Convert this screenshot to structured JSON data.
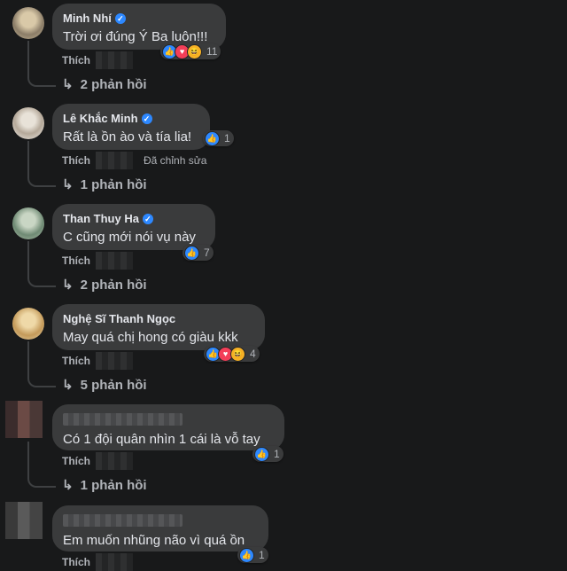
{
  "comments": [
    {
      "name": "Minh Nhí",
      "verified": true,
      "text": "Trời ơi đúng Ý Ba luôn!!!",
      "reactions": [
        "like",
        "love",
        "haha"
      ],
      "reaction_count": "11",
      "like_label": "Thích",
      "edited_label": "",
      "replies_label": "2 phản hồi"
    },
    {
      "name": "Lê Khắc Minh",
      "verified": true,
      "text": "Rất là ồn ào và tía lia!",
      "reactions": [
        "like"
      ],
      "reaction_count": "1",
      "like_label": "Thích",
      "edited_label": "Đã chỉnh sửa",
      "replies_label": "1 phản hồi"
    },
    {
      "name": "Than Thuy Ha",
      "verified": true,
      "text": "C cũng mới nói vụ này",
      "reactions": [
        "like"
      ],
      "reaction_count": "7",
      "like_label": "Thích",
      "edited_label": "",
      "replies_label": "2 phản hồi"
    },
    {
      "name": "Nghệ Sĩ Thanh Ngọc",
      "verified": false,
      "text": "May quá chị hong có giàu kkk",
      "reactions": [
        "like",
        "love",
        "haha"
      ],
      "reaction_count": "4",
      "like_label": "Thích",
      "edited_label": "",
      "replies_label": "5 phản hồi"
    },
    {
      "name": "",
      "verified": false,
      "text": "Có 1 đội quân nhìn 1 cái là vỗ tay",
      "reactions": [
        "like"
      ],
      "reaction_count": "1",
      "like_label": "Thích",
      "edited_label": "",
      "replies_label": "1 phản hồi"
    },
    {
      "name": "",
      "verified": false,
      "text": "Em muốn nhũng não vì quá ồn",
      "reactions": [
        "like"
      ],
      "reaction_count": "1",
      "like_label": "Thích",
      "edited_label": "",
      "replies_label": ""
    }
  ],
  "icons": {
    "verified": "verified-badge-icon",
    "reply": "reply-arrow-icon",
    "like": "like-icon",
    "love": "love-icon",
    "haha": "haha-icon"
  },
  "colors": {
    "background": "#18191a",
    "bubble": "#3a3b3c",
    "accent": "#2d88ff",
    "muted_text": "#b0b3b8"
  }
}
